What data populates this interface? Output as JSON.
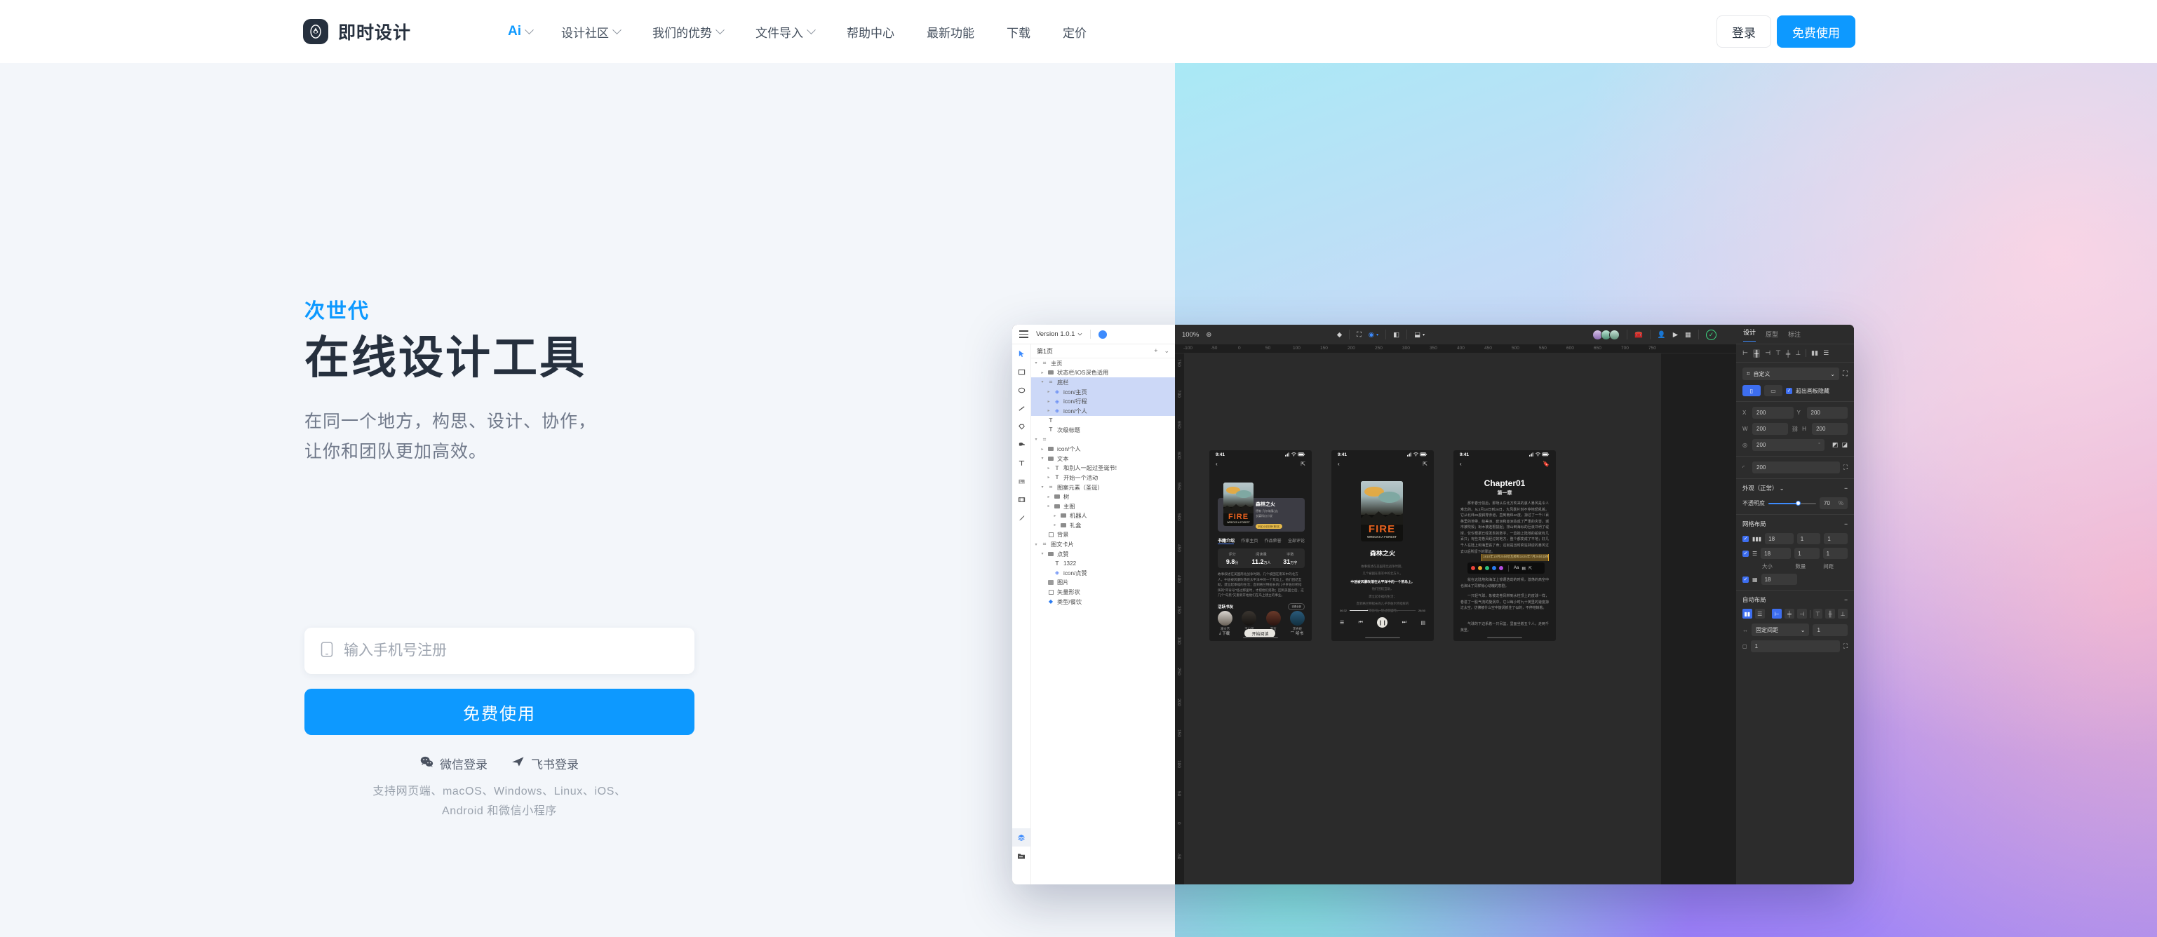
{
  "header": {
    "brand": "即时设计",
    "logo_icon": "droplet-logo-icon",
    "nav": [
      {
        "label": "Ai",
        "caret": true,
        "highlight": true
      },
      {
        "label": "设计社区",
        "caret": true
      },
      {
        "label": "我们的优势",
        "caret": true
      },
      {
        "label": "文件导入",
        "caret": true
      },
      {
        "label": "帮助中心",
        "caret": false
      },
      {
        "label": "最新功能",
        "caret": false
      },
      {
        "label": "下载",
        "caret": false
      },
      {
        "label": "定价",
        "caret": false
      }
    ],
    "login_label": "登录",
    "free_label": "免费使用"
  },
  "hero": {
    "eyebrow": "次世代",
    "headline": "在线设计工具",
    "subcopy_line1": "在同一个地方，构思、设计、协作，",
    "subcopy_line2": "让你和团队更加高效。",
    "phone_placeholder": "输入手机号注册",
    "phone_value": "",
    "phone_icon": "mobile-phone-icon",
    "cta_label": "免费使用",
    "socials": [
      {
        "label": "微信登录",
        "icon": "wechat-icon"
      },
      {
        "label": "飞书登录",
        "icon": "feishu-paperplane-icon"
      }
    ],
    "platforms_line1": "支持网页端、macOS、Windows、Linux、iOS、",
    "platforms_line2": "Android 和微信小程序",
    "accent_color": "#0d99ff",
    "bg_left_color": "#f3f6fa"
  },
  "app": {
    "topbar": {
      "menu_icon": "hamburger-icon",
      "version": "Version 1.0.1",
      "version_caret": "chevron-down-icon",
      "avatar_icon": "user-avatar-icon"
    },
    "page_tab": {
      "name": "第1页",
      "add_icon": "plus-icon",
      "more_icon": "chevron-down-icon"
    },
    "tools": [
      {
        "name": "cursor-tool",
        "glyph": "▶",
        "selected": true
      },
      {
        "name": "rectangle-tool",
        "glyph": "▭"
      },
      {
        "name": "ellipse-tool",
        "glyph": "◯"
      },
      {
        "name": "line-tool",
        "glyph": "╱"
      },
      {
        "name": "polygon-tool",
        "glyph": "⬠"
      },
      {
        "name": "pen-tool",
        "glyph": "✒"
      },
      {
        "name": "text-tool",
        "glyph": "T"
      },
      {
        "name": "image-tool",
        "glyph": "🖼"
      },
      {
        "name": "frame-tool",
        "glyph": "▣"
      },
      {
        "name": "brush-tool",
        "glyph": "🖌"
      }
    ],
    "tools_bottom": [
      {
        "name": "layers-tool",
        "glyph": "▤",
        "selected": true
      },
      {
        "name": "assets-tool",
        "glyph": "🗀"
      }
    ],
    "layers": [
      {
        "label": "主页",
        "depth": 0,
        "icon": "frame",
        "expand": "▾"
      },
      {
        "label": "状态栏/iOS深色适用",
        "depth": 1,
        "icon": "folder",
        "expand": "▸"
      },
      {
        "label": "底栏",
        "depth": 1,
        "icon": "frame",
        "expand": "▾",
        "selected": true
      },
      {
        "label": "icon/主页",
        "depth": 2,
        "icon": "comp",
        "expand": "▸",
        "selected": true
      },
      {
        "label": "icon/行程",
        "depth": 2,
        "icon": "comp",
        "expand": "▸",
        "selected": true
      },
      {
        "label": "icon/个人",
        "depth": 2,
        "icon": "comp",
        "expand": "▸",
        "selected": true
      },
      {
        "label": "",
        "depth": 1,
        "icon": "text",
        "expand": ""
      },
      {
        "label": "次级标题",
        "depth": 1,
        "icon": "text",
        "expand": ""
      },
      {
        "label": "",
        "depth": 0,
        "icon": "frame",
        "expand": "▾"
      },
      {
        "label": "icon/个人",
        "depth": 1,
        "icon": "folder",
        "expand": "▸"
      },
      {
        "label": "文本",
        "depth": 1,
        "icon": "folder",
        "expand": "▾"
      },
      {
        "label": "和别人一起过圣诞节!",
        "depth": 2,
        "icon": "text",
        "expand": "▸"
      },
      {
        "label": "开始一个活动",
        "depth": 2,
        "icon": "text",
        "expand": "▸"
      },
      {
        "label": "图案元素（圣诞）",
        "depth": 1,
        "icon": "frame",
        "expand": "▾"
      },
      {
        "label": "树",
        "depth": 2,
        "icon": "folder",
        "expand": "▸"
      },
      {
        "label": "主图",
        "depth": 2,
        "icon": "folder",
        "expand": "▸"
      },
      {
        "label": "机器人",
        "depth": 3,
        "icon": "folder",
        "expand": "▸"
      },
      {
        "label": "礼盒",
        "depth": 3,
        "icon": "folder",
        "expand": "▸"
      },
      {
        "label": "背景",
        "depth": 1,
        "icon": "rect",
        "expand": ""
      },
      {
        "label": "图文卡片",
        "depth": 0,
        "icon": "frame",
        "expand": "▾"
      },
      {
        "label": "点赞",
        "depth": 1,
        "icon": "folder",
        "expand": "▾"
      },
      {
        "label": "1322",
        "depth": 2,
        "icon": "text",
        "expand": ""
      },
      {
        "label": "icon/点赞",
        "depth": 2,
        "icon": "comp",
        "expand": ""
      },
      {
        "label": "图片",
        "depth": 1,
        "icon": "img",
        "expand": ""
      },
      {
        "label": "矢量形状",
        "depth": 1,
        "icon": "rect",
        "expand": ""
      },
      {
        "label": "类型/餐饮",
        "depth": 1,
        "icon": "diamond",
        "expand": ""
      }
    ],
    "dark_toolbar": {
      "zoom": "100%",
      "zoom_add_icon": "plus-circle-icon",
      "items": [
        {
          "name": "component-icon",
          "glyph": "◆"
        },
        {
          "name": "frame-select-icon",
          "glyph": "⛶"
        },
        {
          "name": "mask-icon",
          "glyph": "◉",
          "active": true,
          "caret": true
        },
        {
          "name": "boolean-icon",
          "glyph": "◧"
        },
        {
          "name": "flatten-icon",
          "glyph": "⬓",
          "caret": true
        }
      ],
      "right_items": [
        {
          "name": "toolbox-icon",
          "glyph": "🧰"
        },
        {
          "name": "invite-user-icon",
          "glyph": "👤"
        },
        {
          "name": "play-present-icon",
          "glyph": "▶"
        },
        {
          "name": "layout-grid-icon",
          "glyph": "▦"
        },
        {
          "name": "saved-check-icon",
          "glyph": "✓"
        }
      ],
      "avatars": [
        "avatar-1",
        "avatar-2",
        "avatar-3"
      ]
    },
    "ruler_h": [
      "-100",
      "-50",
      "0",
      "50",
      "100",
      "150",
      "200",
      "250",
      "300",
      "350",
      "400",
      "450",
      "500",
      "550",
      "600",
      "650",
      "700",
      "750"
    ],
    "ruler_v": [
      "750",
      "700",
      "650",
      "600",
      "550",
      "500",
      "450",
      "400",
      "350",
      "300",
      "250",
      "200",
      "150",
      "100",
      "50",
      "0",
      "-50"
    ],
    "props": {
      "tabs": [
        {
          "label": "设计",
          "active": true
        },
        {
          "label": "原型",
          "active": false
        },
        {
          "label": "标注",
          "active": false
        }
      ],
      "align_icons": [
        "align-left-icon",
        "align-center-h-icon",
        "align-right-icon",
        "align-top-icon",
        "align-middle-v-icon",
        "align-bottom-icon",
        "distribute-h-icon",
        "distribute-v-icon"
      ],
      "constraint_label": "自定义",
      "constraint_icon": "frame-icon",
      "constraint_caret": "chevron-down-icon",
      "reset_icon": "reset-constraint-icon",
      "orient_portrait_icon": "portrait-icon",
      "orient_landscape_icon": "landscape-icon",
      "clip_label": "超出画板隐藏",
      "clip_checked": true,
      "geometry": {
        "x_label": "X",
        "x_value": "200",
        "y_label": "Y",
        "y_value": "200",
        "w_label": "W",
        "w_value": "200",
        "h_label": "H",
        "h_value": "200",
        "link_icon": "link-ratio-icon",
        "rotate_label": "rotation-icon",
        "rotate_value": "200",
        "rotate_unit": "°",
        "flip_h_icon": "flip-horizontal-icon",
        "flip_v_icon": "flip-vertical-icon",
        "corner_icon": "corner-radius-icon",
        "corner_value": "200",
        "corner_independent_icon": "independent-corners-icon"
      },
      "appearance": {
        "title": "外观（正常）",
        "caret": "chevron-down-icon",
        "collapse_icon": "minus-icon",
        "opacity_label": "不透明度",
        "opacity_value": "70",
        "opacity_unit": "%"
      },
      "grid": {
        "title": "网格布局",
        "collapse_icon": "minus-icon",
        "rows": [
          {
            "icon": "columns-icon",
            "checked": true,
            "size": "18",
            "count": "1",
            "gutter": "1"
          },
          {
            "icon": "rows-icon",
            "checked": true,
            "size": "18",
            "count": "1",
            "gutter": "1"
          },
          {
            "icon": "grid-icon",
            "checked": true,
            "size": "18",
            "count": "",
            "gutter": ""
          }
        ],
        "headers": [
          "大小",
          "数量",
          "间距"
        ]
      },
      "autolayout": {
        "title": "自动布局",
        "collapse_icon": "minus-icon",
        "direction_icons": [
          "layout-horizontal-icon",
          "layout-vertical-icon"
        ],
        "align_icons": [
          "align-start-icon",
          "align-center-icon",
          "align-end-icon",
          "align-top2-icon",
          "align-mid2-icon",
          "align-bot2-icon"
        ],
        "spacing_mode_icon": "spacing-icon",
        "spacing_mode": "固定间距",
        "spacing_caret": "chevron-down-icon",
        "spacing_value": "1",
        "padding_icon": "padding-icon",
        "padding_value": "1",
        "padding_detail_icon": "padding-detail-icon"
      }
    },
    "phones": [
      {
        "id": "phone-book-detail",
        "time": "9:41",
        "back_icon": "chevron-left-icon",
        "action_icon": "share-icon",
        "cover_title": "FIRE",
        "cover_sub": "WRECKS A FOREST",
        "book_title": "森林之火",
        "author": "德勒·凡尔纳廉(法)",
        "genre": "长篇科幻小说",
        "badge": "科幻小说日榜·第3名",
        "tabs": [
          "书籍介绍",
          "作家主页",
          "作品荣誉",
          "全部评论"
        ],
        "stats": [
          {
            "label": "评分",
            "value": "9.8",
            "unit": "分"
          },
          {
            "label": "阅读量",
            "value": "11.2",
            "unit": "万人"
          },
          {
            "label": "字数",
            "value": "31",
            "unit": "万字"
          }
        ],
        "description": "故事叙述在美国南北战争时期，几个被困在南军中的北方人，中途被风暴吹落在太平洋中的一个荒岛上。他们团结互助，建立起幸福的生活；直到格兰特船长的儿子罗伯尔所指挥的\"邓肯号\"经过那里时，才把他们搭救；回到美国之后，这几个\"岛民\"又重新开始他们在岛上建立的事业。",
        "friends_title": "活跃书友",
        "friends_more": "查看全部",
        "friends": [
          "潘文芳",
          "王小悍",
          "李石",
          "李秀娅"
        ],
        "actions": [
          {
            "label": "下载",
            "icon": "download-icon"
          },
          {
            "label": "开始阅读",
            "icon": "",
            "primary": true
          },
          {
            "label": "听书",
            "icon": "headphone-icon"
          }
        ]
      },
      {
        "id": "phone-audio-player",
        "time": "9:41",
        "back_icon": "chevron-left-icon",
        "action_icon": "share-icon",
        "cover_title": "FIRE",
        "cover_sub": "WRECKS A FOREST",
        "book_title": "森林之火",
        "lyrics": [
          {
            "text": "故事叙述在美国南北战争时期，",
            "active": false
          },
          {
            "text": "几个被困在南军中的北方人，",
            "active": false
          },
          {
            "text": "中途被风暴吹落在太平洋中的一个荒岛上，",
            "active": true
          },
          {
            "text": "他们团结互助，",
            "active": false
          },
          {
            "text": "建立起幸福的生活；",
            "active": false
          },
          {
            "text": "直到格兰特船长的儿子罗伯尔所指挥的",
            "active": false
          },
          {
            "text": "「邓肯号」经过那里时，",
            "active": false
          }
        ],
        "time_current": "06:32",
        "time_total": "28:50",
        "progress_pct": 28,
        "controls": [
          "playlist-icon",
          "prev-icon",
          "pause-icon",
          "next-icon",
          "bookmark-icon"
        ]
      },
      {
        "id": "phone-reader",
        "time": "9:41",
        "back_icon": "chevron-left-icon",
        "action_icon": "bookmark-icon",
        "chapter_en": "Chapter01",
        "chapter_cn": "第一章",
        "body": "那年春分前后，那场从东北方吹来的骇人暴风是令人难忘的。从3月18日到26日，大风暴片刻不停地怒吼着。它从北纬35度斜穿赤道，直到南纬40度，掠过了一千八百英里的地带，给美洲、欧洲和亚洲造成了严重的灾害。城市被吹毁；树木被连根拔起；排山倒海似的巨浪冲坍了堤岸，仅仅根据已经发表的数字，一直抛上陆地的船就有几百只；有些龙卷风经过的地方，整个都变成了平地；好几千人在陆上和海里丧了命；这就是当时疯狂肆虐的暴风过去以后所留下的罪证。",
        "highlight": "1810年10月25日哈瓦那和1825年7月26日瓜德罗",
        "body2": "就在这陆地和海洋上惨遭浩劫的时候，激荡的高空中也演出了同样惊心动魄的悲剧。",
        "body3": "一只轻气球，象被龙卷风带到水柱顶上的皮球一样，卷进了一股气流的旋涡中，它以每小时九十英里的速度掠过太空，仿佛被什么空中旋涡抓住了似的，不停地转着。",
        "body4": "气球的下边系着一只吊篮，里面坐着五个人，走两千英里。",
        "popup_swatches": [
          "#e8433a",
          "#e8a82c",
          "#2fbf7a",
          "#2a7bf0",
          "#b44ce0"
        ],
        "popup_icons": [
          "font-size-icon",
          "note-icon",
          "share-icon"
        ]
      }
    ]
  }
}
